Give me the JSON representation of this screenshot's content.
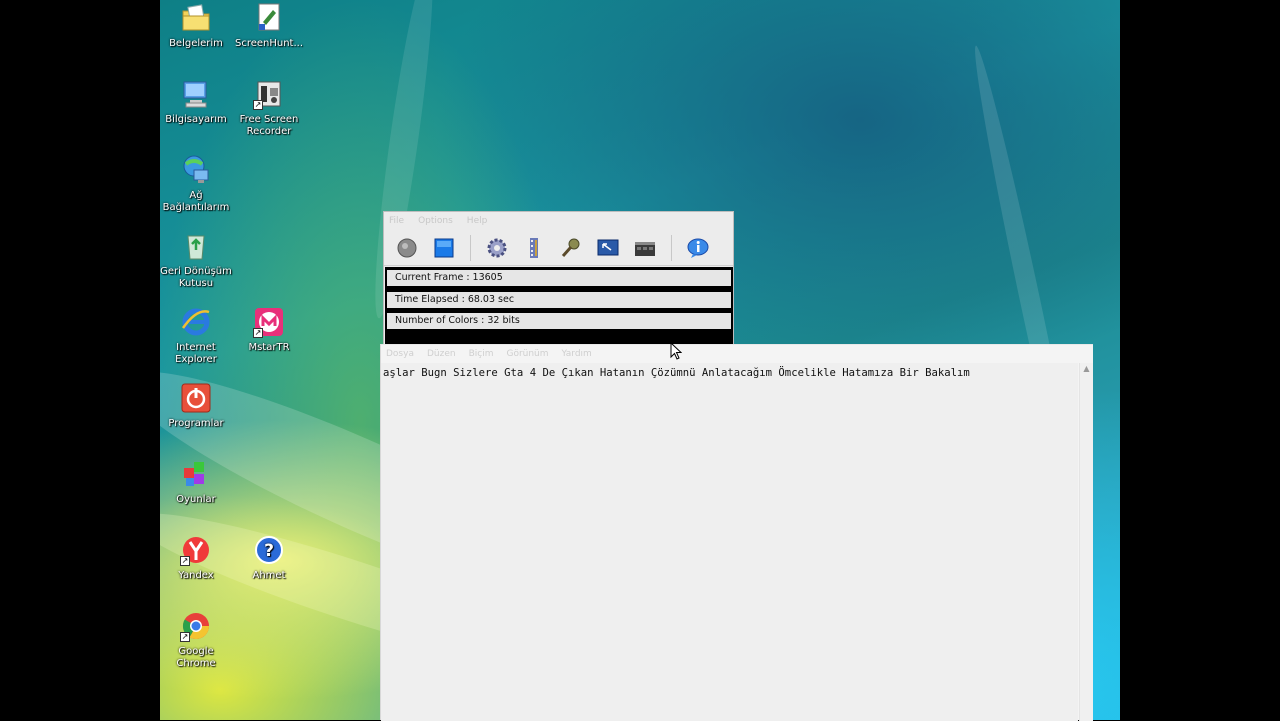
{
  "desktop": {
    "icons": [
      {
        "label": "Belgelerim",
        "icon": "folder-documents-icon"
      },
      {
        "label": "ScreenHunt...",
        "icon": "screenhunter-icon"
      },
      {
        "label": "Bilgisayarım",
        "icon": "my-computer-icon"
      },
      {
        "label": "Free Screen Recorder",
        "icon": "free-screen-recorder-icon"
      },
      {
        "label": "Ağ Bağlantılarım",
        "icon": "network-connections-icon"
      },
      {
        "label": "Geri Dönüşüm Kutusu",
        "icon": "recycle-bin-icon"
      },
      {
        "label": "Internet Explorer",
        "icon": "internet-explorer-icon"
      },
      {
        "label": "MstarTR",
        "icon": "mstartr-icon"
      },
      {
        "label": "Programlar",
        "icon": "programs-power-icon"
      },
      {
        "label": "Oyunlar",
        "icon": "games-icon"
      },
      {
        "label": "Yandex",
        "icon": "yandex-browser-icon"
      },
      {
        "label": "Ahmet",
        "icon": "help-question-icon"
      },
      {
        "label": "Google Chrome",
        "icon": "google-chrome-icon"
      }
    ]
  },
  "recorder": {
    "menu": [
      "File",
      "Options",
      "Help"
    ],
    "toolbar": [
      "record-icon",
      "stop-icon",
      "settings-gear-icon",
      "film-strip-icon",
      "microphone-icon",
      "screen-region-icon",
      "video-clapper-icon",
      "info-icon"
    ],
    "stats": {
      "current_frame": "Current Frame : 13605",
      "time_elapsed": "Time Elapsed : 68.03 sec",
      "number_of_colors": "Number of Colors : 32 bits"
    }
  },
  "notepad": {
    "menu": [
      "Dosya",
      "Düzen",
      "Biçim",
      "Görünüm",
      "Yardım"
    ],
    "text": "aşlar Bugn Sizlere Gta 4 De Çıkan Hatanın Çözümnü Anlatacağım Ömcelikle Hatamıza Bir Bakalım"
  },
  "colors": {
    "recorder_bg": "#ececec",
    "stats_bg": "#000000",
    "notepad_bg": "#efefef"
  }
}
